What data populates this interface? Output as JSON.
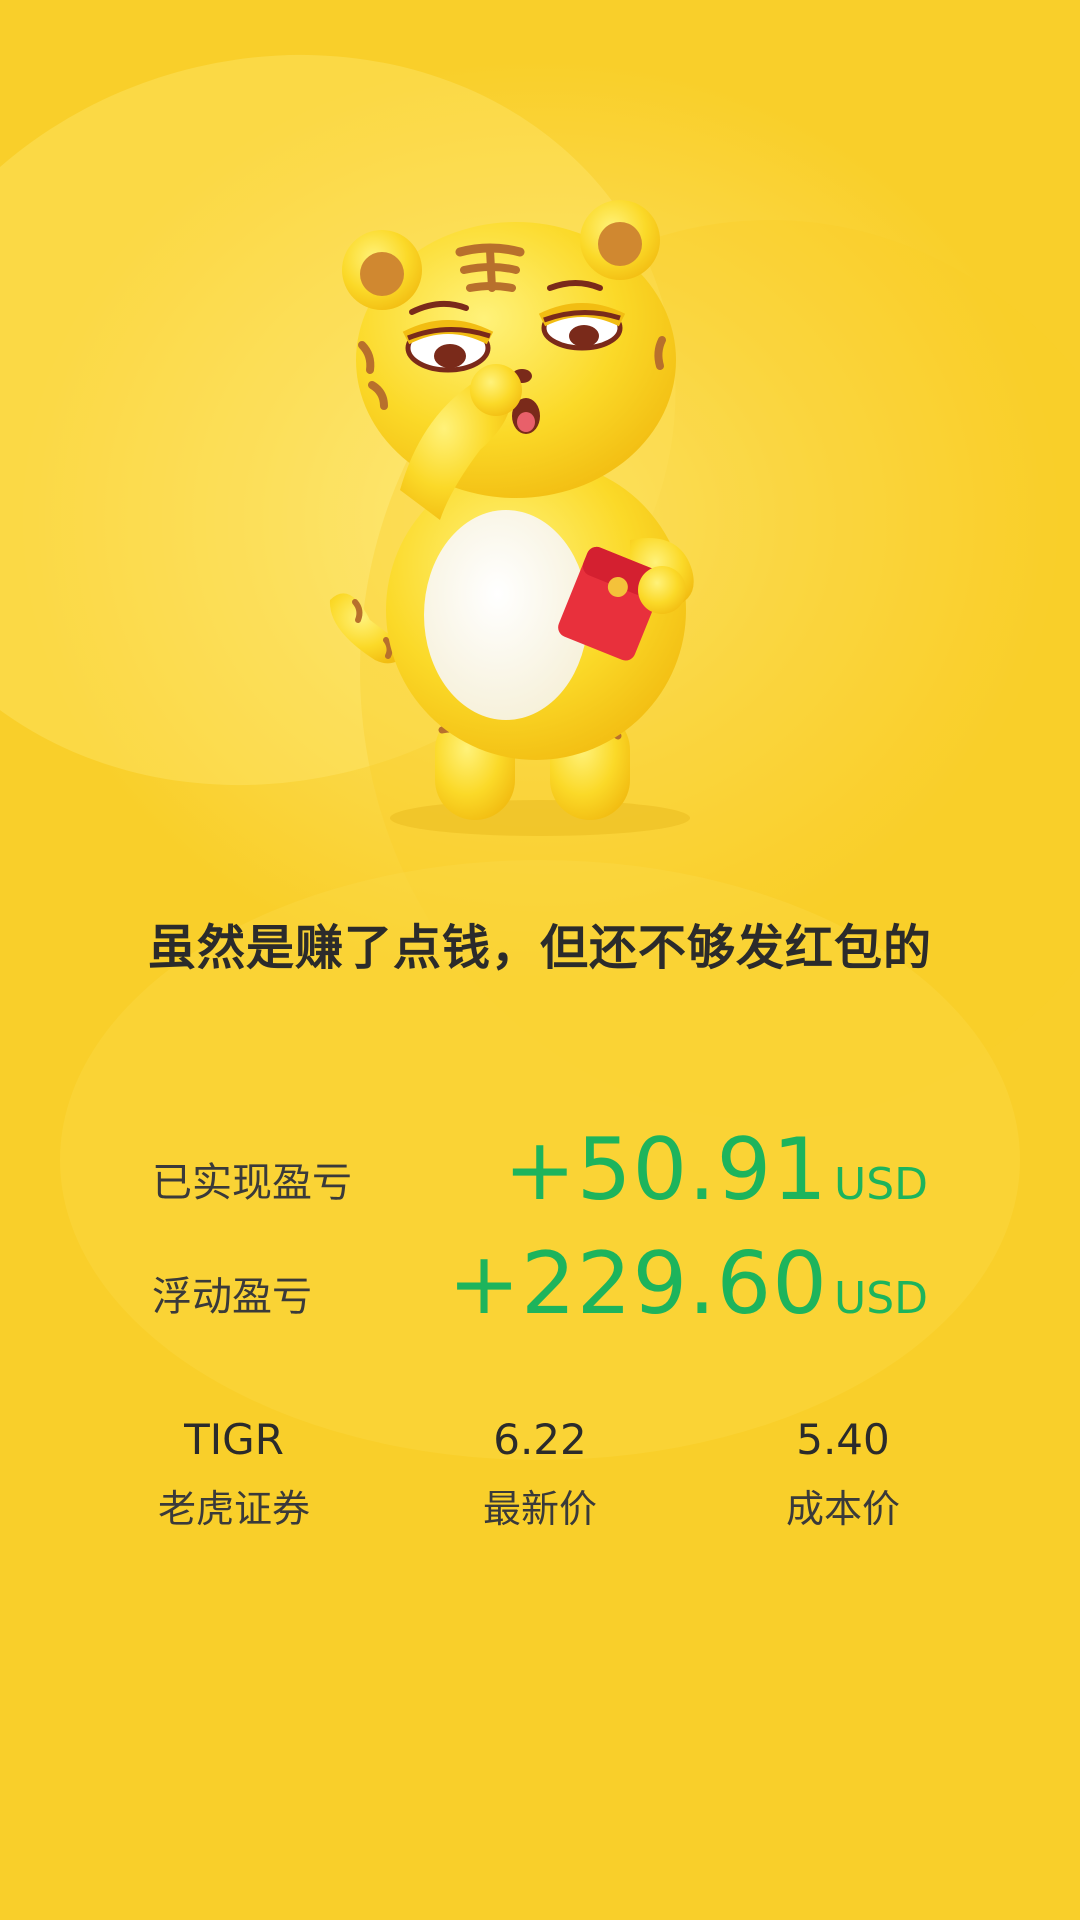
{
  "headline": "虽然是赚了点钱，但还不够发红包的",
  "pnl": [
    {
      "label": "已实现盈亏",
      "value": "+50.91",
      "unit": "USD"
    },
    {
      "label": "浮动盈亏",
      "value": "+229.60",
      "unit": "USD"
    }
  ],
  "stock": {
    "symbol": "TIGR",
    "name": "老虎证券",
    "latest_price": "6.22",
    "latest_price_label": "最新价",
    "cost_price": "5.40",
    "cost_price_label": "成本价"
  },
  "colors": {
    "background": "#fbd94a",
    "profit_green": "#1db45c",
    "text_dark": "#2b2b2b"
  },
  "icons": {
    "mascot": "tiger-mascot-icon",
    "red_envelope": "red-envelope-icon"
  }
}
